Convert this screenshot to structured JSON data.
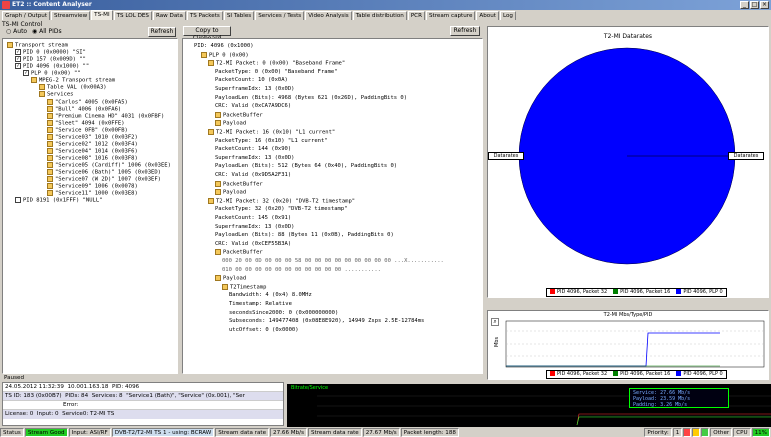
{
  "window": {
    "title": "ET2 :: Content Analyser"
  },
  "tabs": [
    "Graph / Output",
    "Streamview",
    "TS-MI",
    "TS LOL DES",
    "Raw Data",
    "TS Packets",
    "SI Tables",
    "Services / Tests",
    "Video Analysis",
    "Table distribution",
    "PCR",
    "Stream capture",
    "About",
    "Log"
  ],
  "left": {
    "label": "TS-MI Control",
    "radio_a": "Auto",
    "radio_b": "All PIDs",
    "refresh": "Refresh",
    "tree": [
      "Transport stream",
      "PID 0 (0x0000) \"SI\"",
      "PID 157 (0x009D) \"\"",
      "PID 4096 (0x1000) \"\"",
      "PLP 0 (0x00) \"\"",
      "MPEG-2 Transport stream",
      "Table VAL (0x00A3)",
      "Services",
      "\"Carlos\" 4005 (0x0FA5)",
      "\"Bull\" 4006 (0x0FA6)",
      "\"Premium Cinema HD\" 4031 (0x0FBF)",
      "\"Sleet\" 4094 (0x0FFE)",
      "\"Service 0FB\" (0x00FB)",
      "\"Service03\" 1010 (0x03F2)",
      "\"Service02\" 1012 (0x03F4)",
      "\"Service04\" 1014 (0x03F6)",
      "\"Service08\" 1016 (0x03F8)",
      "\"Service05 (Cardiff)\" 1006 (0x03EE)",
      "\"Service06 (Bath)\" 1005 (0x03ED)",
      "\"Service07 (W 2D)\" 1007 (0x03EF)",
      "\"Service09\" 1006 (0x0078)",
      "\"Service11\" 1000 (0x03E8)",
      "PID 8191 (0x1FFF) \"NULL\""
    ],
    "footer": "Paused"
  },
  "middle": {
    "copy": "Copy to Clipboard",
    "refresh": "Refresh",
    "header": "T2-MI Content",
    "lines": [
      "PID: 4096 (0x1000)",
      "PLP 0 (0x00)",
      "T2-MI Packet: 0 (0x00) \"Baseband Frame\"",
      "PacketType: 0 (0x00) \"Baseband Frame\"",
      "PacketCount: 10 (0x0A)",
      "SuperframeIdx: 13 (0x0D)",
      "PayloadLen (Bits): 4968 (Bytes 621 (0x26D), PaddingBits 0)",
      "CRC: Valid (0xCA7A9DC6)",
      "PacketBuffer",
      "Payload",
      "T2-MI Packet: 16 (0x10) \"L1 current\"",
      "PacketType: 16 (0x10) \"L1 current\"",
      "PacketCount: 144 (0x90)",
      "SuperframeIdx: 13 (0x0D)",
      "PayloadLen (Bits): 512 (Bytes 64 (0x40), PaddingBits 0)",
      "CRC: Valid (0x9D5A2F31)",
      "PacketBuffer",
      "Payload",
      "T2-MI Packet: 32 (0x20) \"DVB-T2 timestamp\"",
      "PacketType: 32 (0x20) \"DVB-T2 timestamp\"",
      "PacketCount: 145 (0x91)",
      "SuperframeIdx: 13 (0x0D)",
      "PayloadLen (Bits): 88 (Bytes 11 (0x0B), PaddingBits 0)",
      "CRC: Valid (0xCEF55B3A)",
      "PacketBuffer",
      "000 20 00 0D 00 00 00 58 00 00 00 00 00 00 00 00 00   ...X...........",
      "010 00 00 00 00 00 00 00 00 00 00 00                  ...........",
      "Payload",
      "T2Timestamp",
      "Bandwidth: 4 (0x4) 8.0MHz",
      "Timestamp: Relative",
      "secondsSince2000: 0 (0x000000000)",
      "Subseconds: 149477408 (0x08E8E920), 14949 Zsps 2.5E-12784ms",
      "utcOffset: 0 (0x0000)"
    ]
  },
  "pie": {
    "title": "T2-MI Datarates",
    "left_label": "Datarates",
    "right_label": "Datarates",
    "legend": [
      "PID 4096, Packet 32",
      "PID 4096, Packet 16",
      "PID 4096, PLP 0"
    ],
    "colors": [
      "#ff0000",
      "#008000",
      "#0000ff"
    ]
  },
  "chart_data": {
    "type": "line",
    "title": "T2-MI Mbs/Type/PID",
    "ylabel": "Mbs",
    "series": [
      {
        "name": "PID 4096, Packet 32",
        "color": "#ff0000"
      },
      {
        "name": "PID 4096, Packet 16",
        "color": "#008000"
      },
      {
        "name": "PID 4096, PLP 0",
        "color": "#0000ff"
      }
    ]
  },
  "bottom_info": {
    "rows": [
      [
        "24.05.2012 11:32:39",
        "10.001.163.18",
        "PID: 4096",
        "",
        "",
        ""
      ],
      [
        "TS ID: 183 (0x00B7)",
        "PIDs: 84",
        "Services: 8",
        "\"Service1 (Bath)\", \"Service\" (0x.001), \"Ser"
      ],
      [
        "",
        "Error:",
        "",
        ""
      ],
      [
        "License: 0",
        "Input: 0",
        "Service0: T2-MI TS",
        "",
        "",
        ""
      ]
    ]
  },
  "monitor": {
    "title": "Bitrate/Service",
    "rates": [
      "Service: 27.66 Mb/s",
      "Payload: 23.59 Mb/s",
      "Padding: 3.26 Mb/s"
    ]
  },
  "status": {
    "status_label": "Status",
    "status_val": "Stream Good",
    "input_label": "Input: ASI/RF",
    "input_val": "DVB-T2/T2-MI TS 1 - using: BCRAW",
    "stream_rate_label": "Stream data rate",
    "stream_rate": "27.66 Mb/s",
    "data_rate_label": "Stream data rate",
    "data_rate": "27.67 Mb/s",
    "packet_len": "Packet length: 188",
    "priority_label": "Priority:",
    "priority": "1",
    "other": "Other",
    "cpu": "CPU",
    "cpu_val": "11%"
  }
}
